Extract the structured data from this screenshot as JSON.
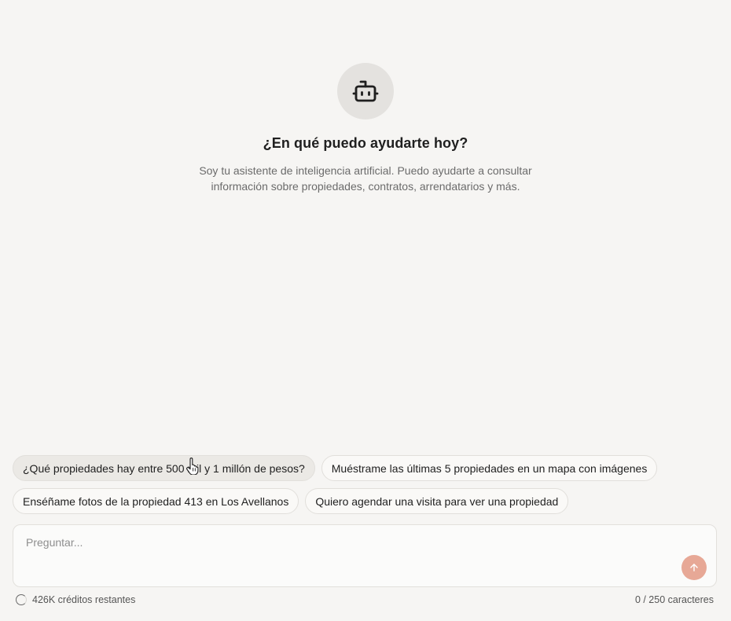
{
  "hero": {
    "icon": "bot-icon",
    "title": "¿En qué puedo ayudarte hoy?",
    "subtitle": "Soy tu asistente de inteligencia artificial. Puedo ayudarte a consultar información sobre propiedades, contratos, arrendatarios y más."
  },
  "suggestions": [
    {
      "label": "¿Qué propiedades hay entre 500 mil y 1 millón de pesos?"
    },
    {
      "label": "Muéstrame las últimas 5 propiedades en un mapa con imágenes"
    },
    {
      "label": "Enséñame fotos de la propiedad 413 en Los Avellanos"
    },
    {
      "label": "Quiero agendar una visita para ver una propiedad"
    }
  ],
  "composer": {
    "placeholder": "Preguntar...",
    "value": "",
    "send_icon": "arrow-up-icon",
    "send_color": "#e7a896"
  },
  "footer": {
    "credits": "426K créditos restantes",
    "char_count": "0 / 250 caracteres"
  }
}
